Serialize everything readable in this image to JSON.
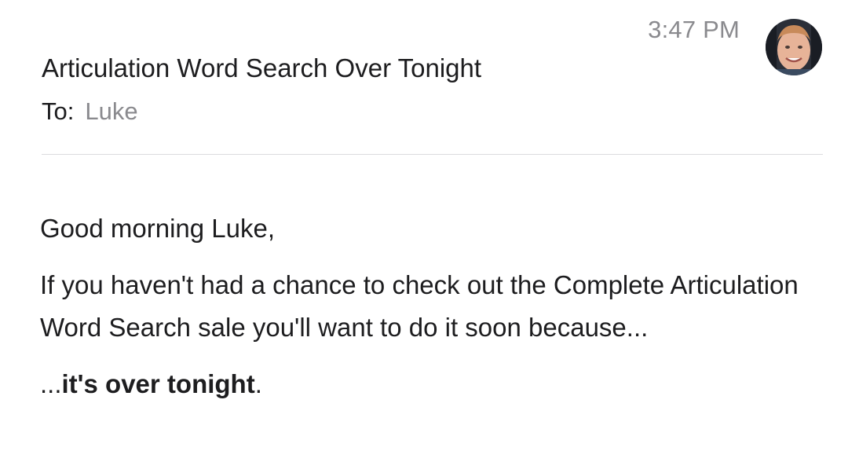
{
  "header": {
    "timestamp": "3:47 PM",
    "subject": "Articulation Word Search Over Tonight",
    "to_label": "To:",
    "to_recipient": "Luke",
    "avatar_icon": "sender-avatar-photo"
  },
  "body": {
    "greeting": "Good morning Luke,",
    "paragraph_1": "If you haven't had a chance to check out the Complete Articulation Word Search sale you'll want to do it soon because...",
    "closing_prefix": "...",
    "closing_bold": "it's over tonight",
    "closing_suffix": "."
  },
  "colors": {
    "text": "#1d1d1f",
    "secondary_text": "#8a8a8e",
    "divider": "#dcdcdf"
  }
}
